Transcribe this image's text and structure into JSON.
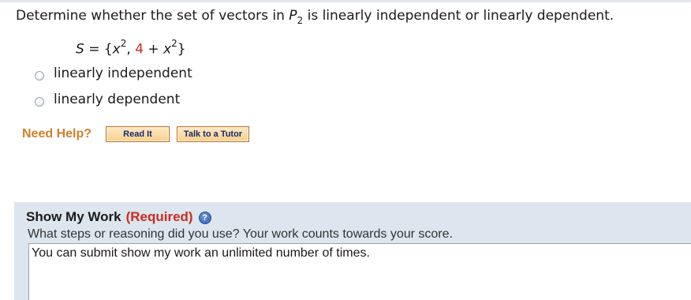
{
  "question": {
    "prefix": "Determine whether the set of vectors in ",
    "space_letter": "P",
    "space_subscript": "2",
    "suffix": " is linearly independent or linearly dependent."
  },
  "set": {
    "label": "S",
    "equals": " = {",
    "v1_base": "x",
    "v1_exp": "2",
    "sep": ", ",
    "v2_const": "4",
    "v2_plus": " + ",
    "v2_base": "x",
    "v2_exp": "2",
    "close": "}"
  },
  "options": [
    {
      "label": "linearly independent",
      "selected": false
    },
    {
      "label": "linearly dependent",
      "selected": false
    }
  ],
  "help": {
    "label": "Need Help?",
    "read_it": "Read It",
    "talk_tutor": "Talk to a Tutor"
  },
  "show_work": {
    "title": "Show My Work",
    "required": "(Required)",
    "help_icon_glyph": "?",
    "description": "What steps or reasoning did you use? Your work counts towards your score.",
    "textarea_value": "You can submit show my work an unlimited number of times."
  },
  "colors": {
    "accent_orange": "#d0802a",
    "required_red": "#cc2a1f",
    "panel_bg": "#dde6ef"
  }
}
